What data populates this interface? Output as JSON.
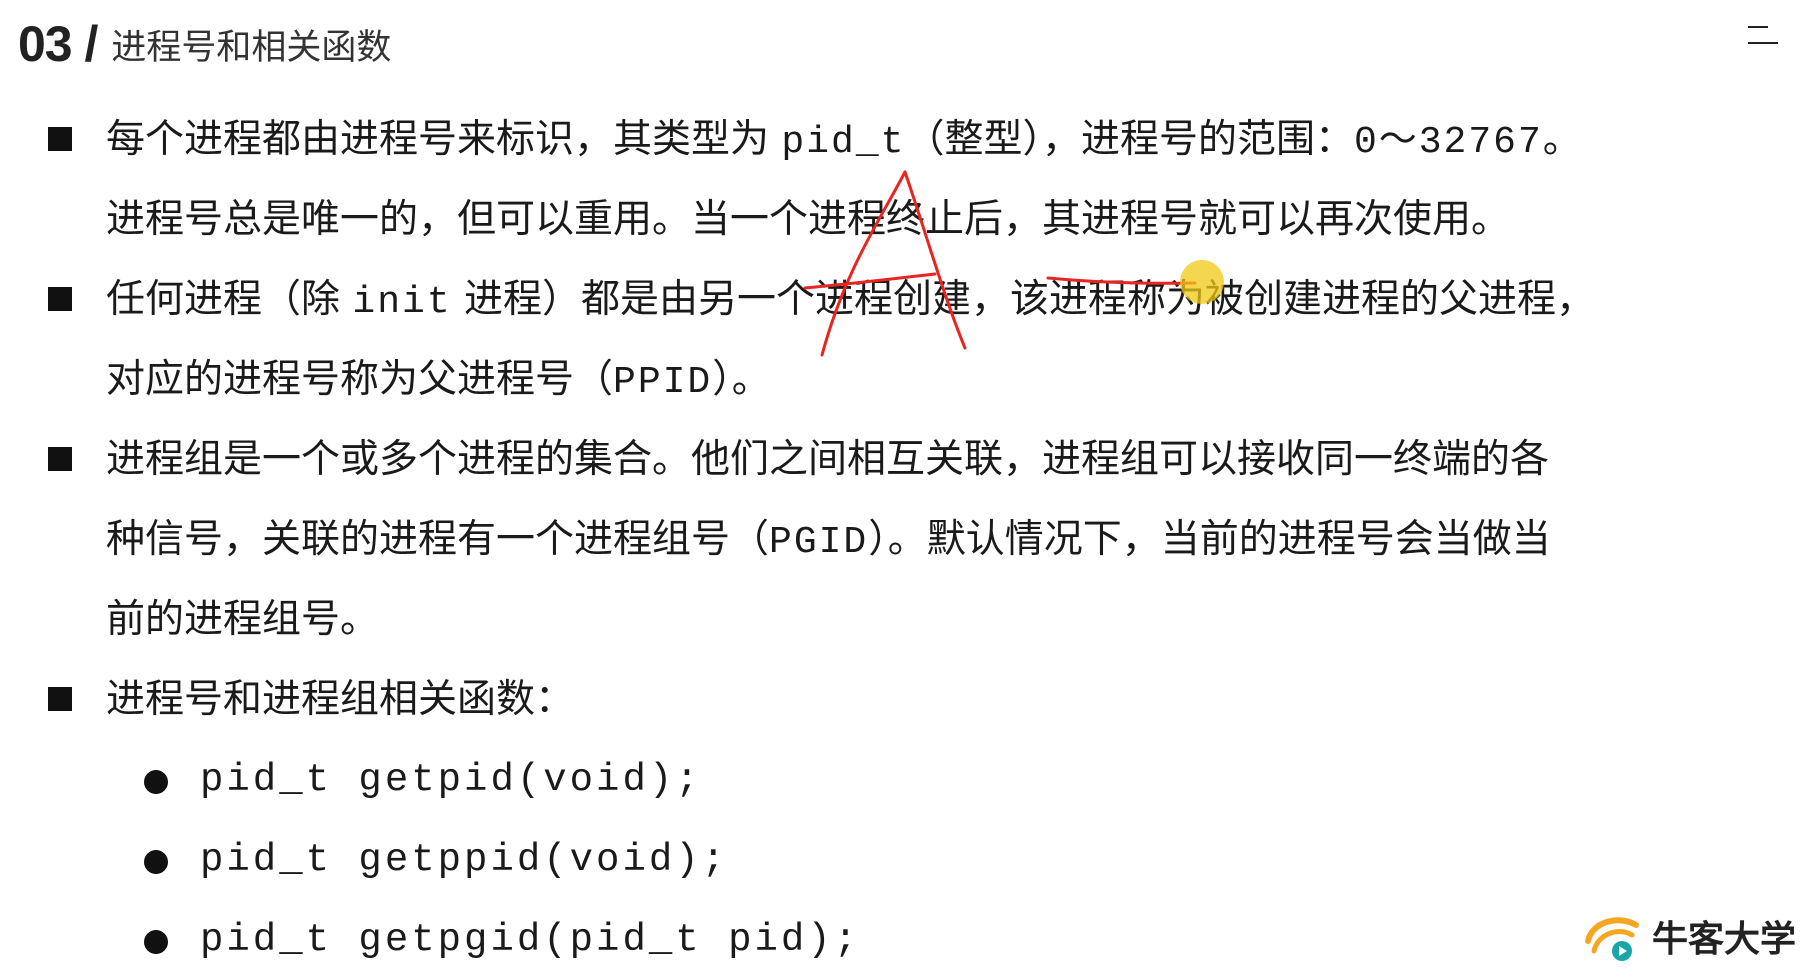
{
  "header": {
    "section_number": "03 /",
    "section_title": "进程号和相关函数"
  },
  "bullets": [
    {
      "lines": [
        [
          "每个进程都由进程号来标识，其类型为 ",
          {
            "mono": "pid_t"
          },
          "（整型），进程号的范围：",
          {
            "mono": "0～32767"
          },
          "。"
        ],
        [
          "进程号总是唯一的，但可以重用。当一个进程终止后，其进程号就可以再次使用。"
        ]
      ]
    },
    {
      "lines": [
        [
          "任何进程（除 ",
          {
            "mono": "init"
          },
          " 进程）都是由另一个进程创建，该进程称为被创建进程的父进程，"
        ],
        [
          "对应的进程号称为父进程号（",
          {
            "mono": "PPID"
          },
          "）。"
        ]
      ]
    },
    {
      "lines": [
        [
          "进程组是一个或多个进程的集合。他们之间相互关联，进程组可以接收同一终端的各"
        ],
        [
          "种信号，关联的进程有一个进程组号（",
          {
            "mono": "PGID"
          },
          "）。默认情况下，当前的进程号会当做当"
        ],
        [
          "前的进程组号。"
        ]
      ]
    },
    {
      "lines": [
        [
          "进程号和进程组相关函数："
        ]
      ]
    }
  ],
  "functions": [
    "pid_t getpid(void);",
    "pid_t getppid(void);",
    "pid_t getpgid(pid_t pid);"
  ],
  "logo": {
    "text": "牛客大学",
    "icon": "nowcoder-logo-icon"
  },
  "colors": {
    "annotation_red": "#e8251f",
    "cursor_yellow": "#f0c814",
    "logo_orange": "#f5a623",
    "logo_teal": "#1aa6a6"
  },
  "icons": {
    "menu": "hamburger-menu-icon"
  }
}
